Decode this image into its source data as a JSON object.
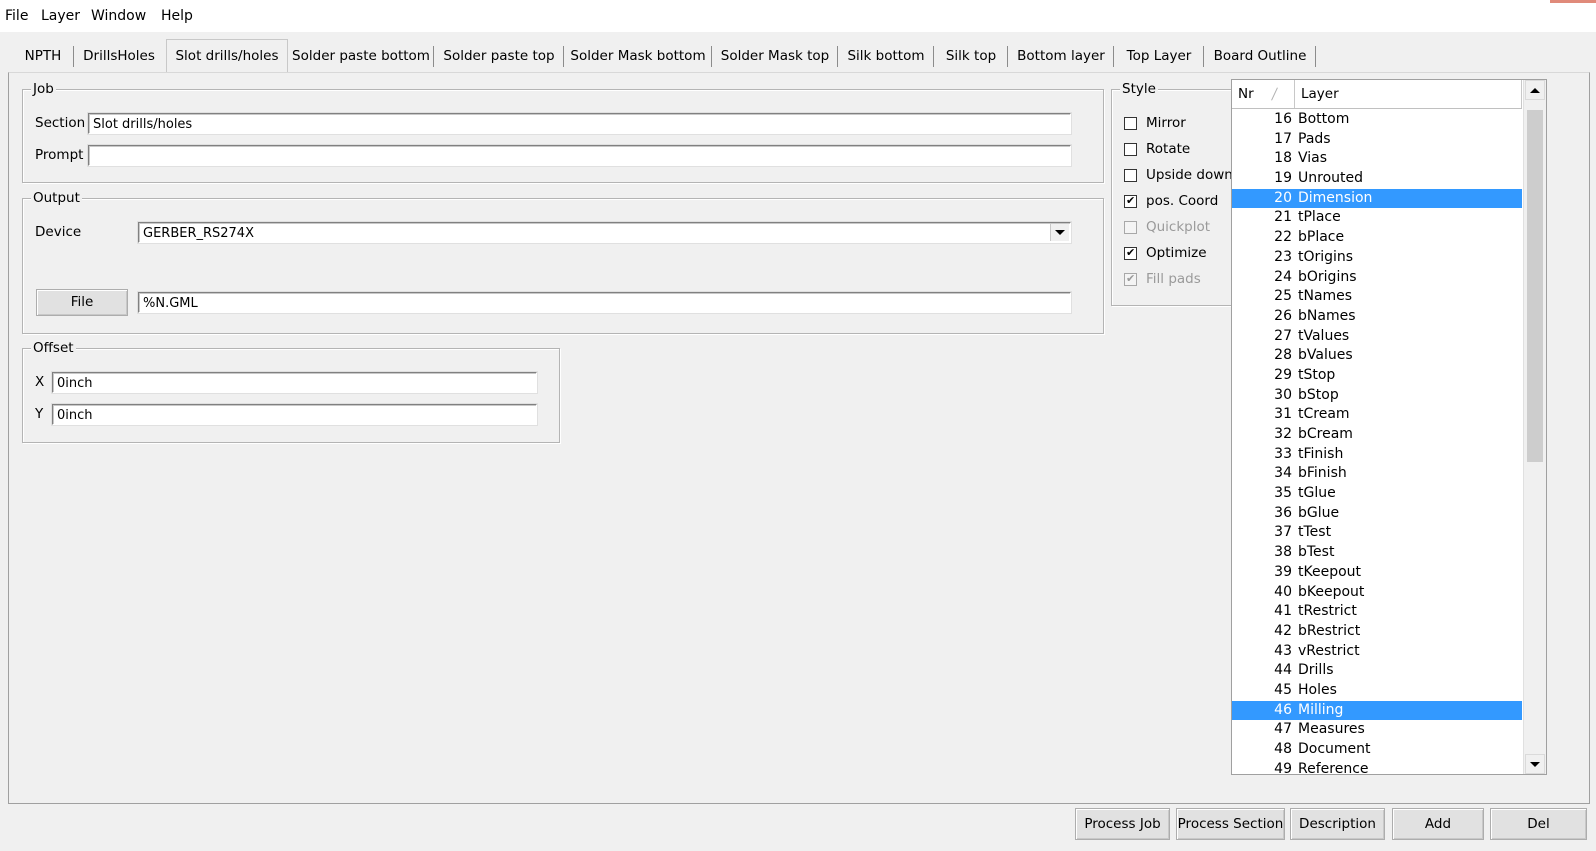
{
  "menu": [
    "File",
    "Layer",
    "Window",
    "Help"
  ],
  "tabs": [
    "NPTH",
    "DrillsHoles",
    "Slot drills/holes",
    "Solder paste bottom",
    "Solder paste top",
    "Solder Mask bottom",
    "Solder Mask top",
    "Silk bottom",
    "Silk top",
    "Bottom layer",
    "Top Layer",
    "Board Outline"
  ],
  "active_tab": "Slot drills/holes",
  "job": {
    "title": "Job",
    "section_label": "Section",
    "section_value": "Slot drills/holes",
    "prompt_label": "Prompt",
    "prompt_value": ""
  },
  "output": {
    "title": "Output",
    "device_label": "Device",
    "device_value": "GERBER_RS274X",
    "file_button": "File",
    "file_value": "%N.GML"
  },
  "offset": {
    "title": "Offset",
    "x_label": "X",
    "x_value": "0inch",
    "y_label": "Y",
    "y_value": "0inch"
  },
  "style": {
    "title": "Style",
    "options": [
      {
        "label": "Mirror",
        "checked": false,
        "enabled": true
      },
      {
        "label": "Rotate",
        "checked": false,
        "enabled": true
      },
      {
        "label": "Upside down",
        "checked": false,
        "enabled": true
      },
      {
        "label": "pos. Coord",
        "checked": true,
        "enabled": true
      },
      {
        "label": "Quickplot",
        "checked": false,
        "enabled": false
      },
      {
        "label": "Optimize",
        "checked": true,
        "enabled": true
      },
      {
        "label": "Fill pads",
        "checked": true,
        "enabled": false
      }
    ]
  },
  "layer_list": {
    "columns": [
      "Nr",
      "Layer"
    ],
    "selection_color": "#3399ff",
    "rows": [
      {
        "nr": "16",
        "name": "Bottom",
        "selected": false
      },
      {
        "nr": "17",
        "name": "Pads",
        "selected": false
      },
      {
        "nr": "18",
        "name": "Vias",
        "selected": false
      },
      {
        "nr": "19",
        "name": "Unrouted",
        "selected": false
      },
      {
        "nr": "20",
        "name": "Dimension",
        "selected": true
      },
      {
        "nr": "21",
        "name": "tPlace",
        "selected": false
      },
      {
        "nr": "22",
        "name": "bPlace",
        "selected": false
      },
      {
        "nr": "23",
        "name": "tOrigins",
        "selected": false
      },
      {
        "nr": "24",
        "name": "bOrigins",
        "selected": false
      },
      {
        "nr": "25",
        "name": "tNames",
        "selected": false
      },
      {
        "nr": "26",
        "name": "bNames",
        "selected": false
      },
      {
        "nr": "27",
        "name": "tValues",
        "selected": false
      },
      {
        "nr": "28",
        "name": "bValues",
        "selected": false
      },
      {
        "nr": "29",
        "name": "tStop",
        "selected": false
      },
      {
        "nr": "30",
        "name": "bStop",
        "selected": false
      },
      {
        "nr": "31",
        "name": "tCream",
        "selected": false
      },
      {
        "nr": "32",
        "name": "bCream",
        "selected": false
      },
      {
        "nr": "33",
        "name": "tFinish",
        "selected": false
      },
      {
        "nr": "34",
        "name": "bFinish",
        "selected": false
      },
      {
        "nr": "35",
        "name": "tGlue",
        "selected": false
      },
      {
        "nr": "36",
        "name": "bGlue",
        "selected": false
      },
      {
        "nr": "37",
        "name": "tTest",
        "selected": false
      },
      {
        "nr": "38",
        "name": "bTest",
        "selected": false
      },
      {
        "nr": "39",
        "name": "tKeepout",
        "selected": false
      },
      {
        "nr": "40",
        "name": "bKeepout",
        "selected": false
      },
      {
        "nr": "41",
        "name": "tRestrict",
        "selected": false
      },
      {
        "nr": "42",
        "name": "bRestrict",
        "selected": false
      },
      {
        "nr": "43",
        "name": "vRestrict",
        "selected": false
      },
      {
        "nr": "44",
        "name": "Drills",
        "selected": false
      },
      {
        "nr": "45",
        "name": "Holes",
        "selected": false
      },
      {
        "nr": "46",
        "name": "Milling",
        "selected": true
      },
      {
        "nr": "47",
        "name": "Measures",
        "selected": false
      },
      {
        "nr": "48",
        "name": "Document",
        "selected": false
      },
      {
        "nr": "49",
        "name": "Reference",
        "selected": false
      }
    ]
  },
  "bottom_buttons": [
    "Process Job",
    "Process Section",
    "Description",
    "Add",
    "Del"
  ]
}
